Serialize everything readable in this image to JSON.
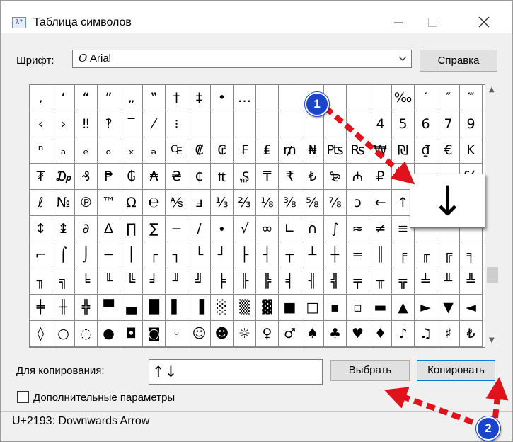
{
  "window": {
    "title": "Таблица символов",
    "icon": "charmap-app-icon"
  },
  "font": {
    "label": "Шрифт:",
    "value": "Arial",
    "glyph": "O"
  },
  "help_button": "Справка",
  "grid": [
    [
      ",",
      "‘",
      "“",
      "”",
      "„",
      "‟",
      "†",
      "‡",
      "•",
      "…",
      "",
      "",
      "",
      "",
      "",
      "",
      "‰",
      "′",
      "″",
      "‴"
    ],
    [
      "‹",
      "›",
      "‼",
      "‽",
      "‾",
      "⁄",
      "⁝",
      "",
      "",
      "",
      "",
      "",
      "",
      "",
      "",
      "4",
      "5",
      "6",
      "7",
      "9"
    ],
    [
      "ⁿ",
      "ₐ",
      "ₑ",
      "ₒ",
      "ₓ",
      "ₔ",
      "₠",
      "₡",
      "₢",
      "₣",
      "₤",
      "₥",
      "₦",
      "₧",
      "₨",
      "₩",
      "₪",
      "₫",
      "€",
      "₭"
    ],
    [
      "₮",
      "₯",
      "₰",
      "₱",
      "₲",
      "₳",
      "₴",
      "₵",
      "₶",
      "₷",
      "₸",
      "₹",
      "₺",
      "₻",
      "₼",
      "₽",
      "",
      "",
      "",
      "℅"
    ],
    [
      "ℓ",
      "№",
      "℗",
      "™",
      "Ω",
      "℮",
      "⅍",
      "ⅎ",
      "⅓",
      "⅔",
      "⅛",
      "⅜",
      "⅝",
      "⅞",
      "ↄ",
      "←",
      "↑",
      "",
      "",
      ""
    ],
    [
      "↕",
      "↨",
      "∂",
      "∆",
      "∏",
      "∑",
      "−",
      "∕",
      "∙",
      "√",
      "∞",
      "∟",
      "∩",
      "∫",
      "≈",
      "≠",
      "≡",
      "",
      "",
      ""
    ],
    [
      "⌐",
      "⌠",
      "⌡",
      "─",
      "│",
      "┌",
      "┐",
      "└",
      "┘",
      "├",
      "┤",
      "┬",
      "┴",
      "┼",
      "═",
      "║",
      "╒",
      "╓",
      "╔",
      "╕"
    ],
    [
      "╖",
      "╗",
      "╘",
      "╙",
      "╚",
      "╛",
      "╜",
      "╝",
      "╞",
      "╟",
      "╠",
      "╡",
      "╢",
      "╣",
      "╤",
      "╥",
      "╦",
      "╧",
      "╨",
      "╩"
    ],
    [
      "╪",
      "╫",
      "╬",
      "▀",
      "▄",
      "█",
      "▌",
      "▐",
      "░",
      "▒",
      "▓",
      "■",
      "□",
      "▪",
      "▫",
      "▬",
      "▲",
      "►",
      "▼",
      "◄"
    ],
    [
      "◊",
      "○",
      "◌",
      "●",
      "◘",
      "◙",
      "◦",
      "☺",
      "☻",
      "☼",
      "♀",
      "♂",
      "♠",
      "♣",
      "♥",
      "♦",
      "♪",
      "♫",
      "♯",
      "₺"
    ]
  ],
  "zoom_char": "↓",
  "copy": {
    "label": "Для копирования:",
    "value": "↑↓",
    "select_button": "Выбрать",
    "copy_button": "Копировать"
  },
  "advanced_label": "Дополнительные параметры",
  "status": "U+2193: Downwards Arrow",
  "annotations": {
    "badge1": "1",
    "badge2": "2",
    "arrow_color": "#e0121b",
    "badge_color": "#1a44c9"
  }
}
